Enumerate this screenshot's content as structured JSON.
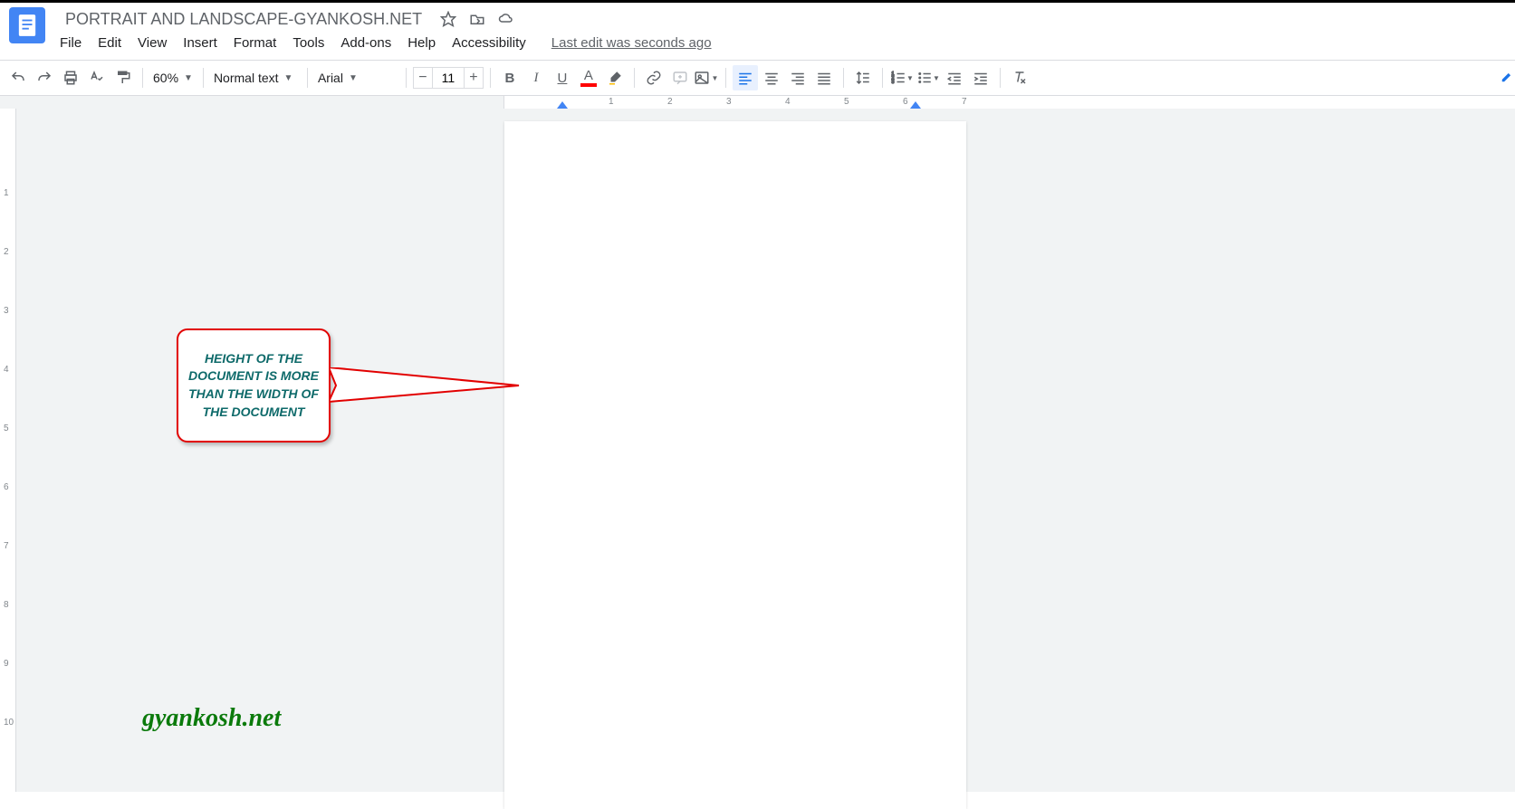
{
  "doc": {
    "title": "PORTRAIT AND LANDSCAPE-GYANKOSH.NET"
  },
  "menus": {
    "file": "File",
    "edit": "Edit",
    "view": "View",
    "insert": "Insert",
    "format": "Format",
    "tools": "Tools",
    "addons": "Add-ons",
    "help": "Help",
    "accessibility": "Accessibility",
    "last_edit": "Last edit was seconds ago"
  },
  "toolbar": {
    "zoom": "60%",
    "style": "Normal text",
    "font": "Arial",
    "font_size": "11",
    "text_color_letter": "A"
  },
  "ruler": {
    "h_labels": [
      "1",
      "1",
      "2",
      "3",
      "4",
      "5",
      "6",
      "7"
    ],
    "v_labels": [
      "1",
      "2",
      "3",
      "4",
      "5",
      "6",
      "7",
      "8",
      "9",
      "10"
    ]
  },
  "callout": {
    "text": "HEIGHT OF THE DOCUMENT IS MORE THAN THE WIDTH OF THE DOCUMENT"
  },
  "watermark": {
    "text": "gyankosh.net"
  }
}
